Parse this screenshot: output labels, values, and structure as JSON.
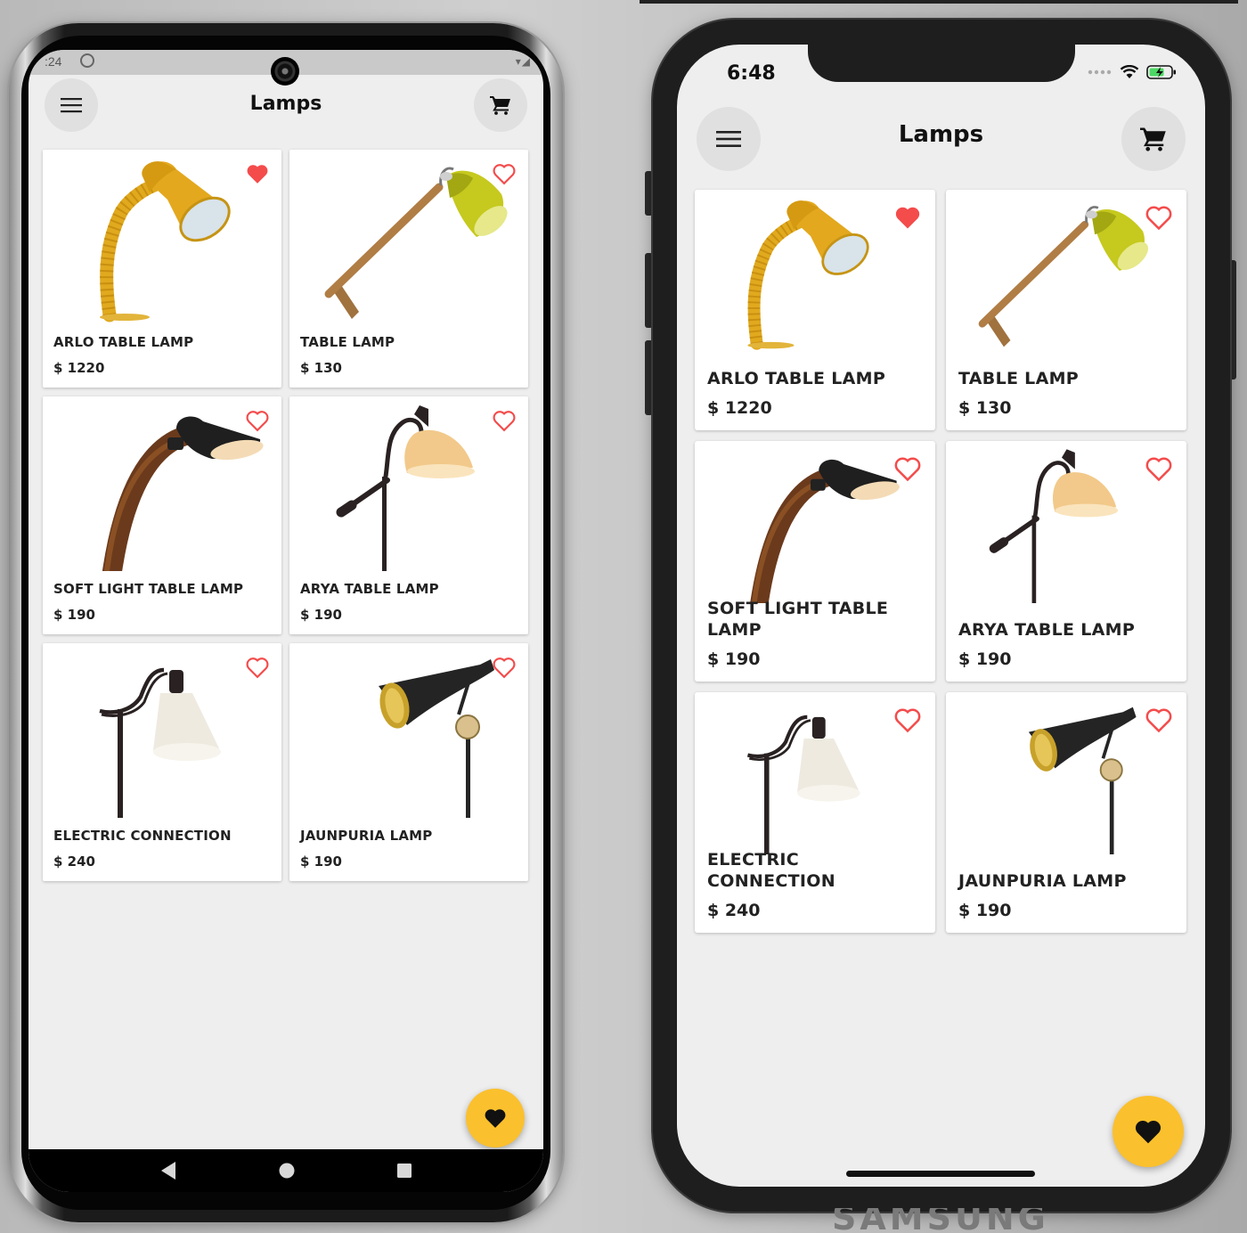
{
  "android": {
    "status": {
      "time": ":24"
    },
    "title": "Lamps",
    "products": [
      {
        "name": "ARLO TABLE LAMP",
        "price": "$ 1220",
        "favorite": true,
        "lamp": "yellow-gooseneck"
      },
      {
        "name": "TABLE LAMP",
        "price": "$ 130",
        "favorite": false,
        "lamp": "yellow-wood-arm"
      },
      {
        "name": "SOFT LIGHT TABLE LAMP",
        "price": "$ 190",
        "favorite": false,
        "lamp": "black-curved-wood"
      },
      {
        "name": "ARYA TABLE LAMP",
        "price": "$ 190",
        "favorite": false,
        "lamp": "amber-floor"
      },
      {
        "name": "ELECTRIC CONNECTION",
        "price": "$ 240",
        "favorite": false,
        "lamp": "white-floor"
      },
      {
        "name": "JAUNPURIA LAMP",
        "price": "$ 190",
        "favorite": false,
        "lamp": "black-gold-floor"
      }
    ]
  },
  "iphone": {
    "status": {
      "time": "6:48"
    },
    "title": "Lamps",
    "products": [
      {
        "name": "ARLO TABLE LAMP",
        "price": "$ 1220",
        "favorite": true,
        "lamp": "yellow-gooseneck"
      },
      {
        "name": "TABLE LAMP",
        "price": "$ 130",
        "favorite": false,
        "lamp": "yellow-wood-arm"
      },
      {
        "name": "SOFT LIGHT TABLE LAMP",
        "price": "$ 190",
        "favorite": false,
        "lamp": "black-curved-wood"
      },
      {
        "name": "ARYA TABLE LAMP",
        "price": "$ 190",
        "favorite": false,
        "lamp": "amber-floor"
      },
      {
        "name": "ELECTRIC CONNECTION",
        "price": "$ 240",
        "favorite": false,
        "lamp": "white-floor"
      },
      {
        "name": "JAUNPURIA LAMP",
        "price": "$ 190",
        "favorite": false,
        "lamp": "black-gold-floor"
      }
    ]
  },
  "icons": {
    "menu": "hamburger-icon",
    "cart": "cart-icon",
    "favorite": "heart-icon",
    "fab": "heart-icon",
    "nav_back": "back-triangle-icon",
    "nav_home": "home-circle-icon",
    "nav_recents": "recents-square-icon"
  },
  "brand_text": "SAMSUNG",
  "colors": {
    "background": "#eeeeee",
    "card": "#ffffff",
    "heart": "#f44b4b",
    "fab": "#fbc02d",
    "header_button": "#e0e0e0"
  }
}
